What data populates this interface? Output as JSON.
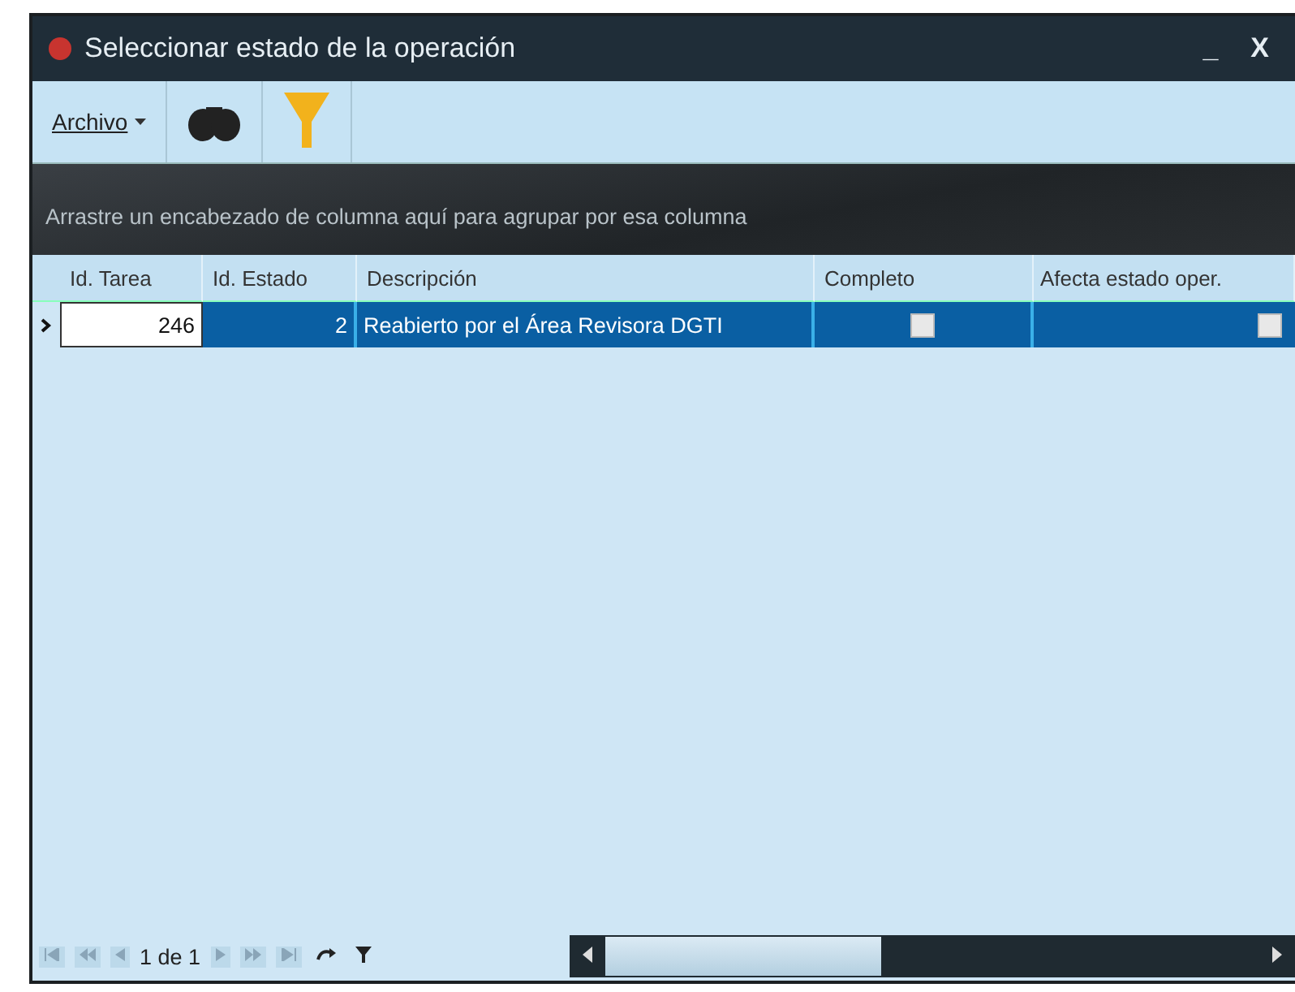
{
  "window": {
    "title": "Seleccionar estado de la operación",
    "minimize": "_",
    "close": "X"
  },
  "toolbar": {
    "menu": "Archivo"
  },
  "group_panel": {
    "text": "Arrastre un encabezado de columna aquí para agrupar por esa columna"
  },
  "table": {
    "columns": [
      "Id. Tarea",
      "Id. Estado",
      "Descripción",
      "Completo",
      "Afecta estado oper."
    ],
    "rows": [
      {
        "selected": true,
        "cells": [
          "246",
          "2",
          "Reabierto por el Área Revisora DGTI"
        ],
        "completo": false,
        "afecta": false
      }
    ]
  },
  "navigator": {
    "page": "1 de 1"
  }
}
